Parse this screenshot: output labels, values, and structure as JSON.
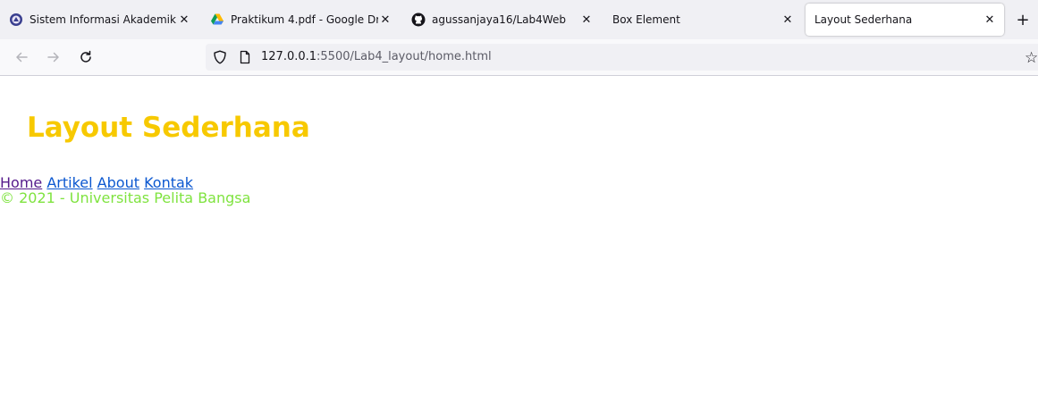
{
  "browser": {
    "tabs": [
      {
        "title": "Sistem Informasi Akademik",
        "icon": "university-seal-icon",
        "active": false
      },
      {
        "title": "Praktikum 4.pdf - Google Drive",
        "icon": "google-drive-icon",
        "active": false
      },
      {
        "title": "agussanjaya16/Lab4Web",
        "icon": "github-icon",
        "active": false
      },
      {
        "title": "Box Element",
        "icon": "",
        "active": false
      },
      {
        "title": "Layout Sederhana",
        "icon": "",
        "active": true
      }
    ],
    "url_host": "127.0.0.1",
    "url_rest": ":5500/Lab4_layout/home.html",
    "icons": {
      "back": "back-arrow-icon",
      "forward": "forward-arrow-icon",
      "reload": "reload-icon",
      "shield": "tracking-protection-shield-icon",
      "page": "page-icon",
      "bookmark": "bookmark-star-icon",
      "new_tab": "plus-icon",
      "close": "close-icon"
    }
  },
  "page": {
    "heading": "Layout Sederhana",
    "nav": {
      "home": "Home",
      "artikel": "Artikel",
      "about": "About",
      "kontak": "Kontak"
    },
    "footer": "© 2021 - Universitas Pelita Bangsa"
  },
  "colors": {
    "heading": "#f7c900",
    "footer": "#7fe33f",
    "link": "#0b57d0",
    "visited_link": "#551a8b",
    "tabstrip_bg": "#f0f0f4",
    "toolbar_bg": "#f9f9fb"
  }
}
